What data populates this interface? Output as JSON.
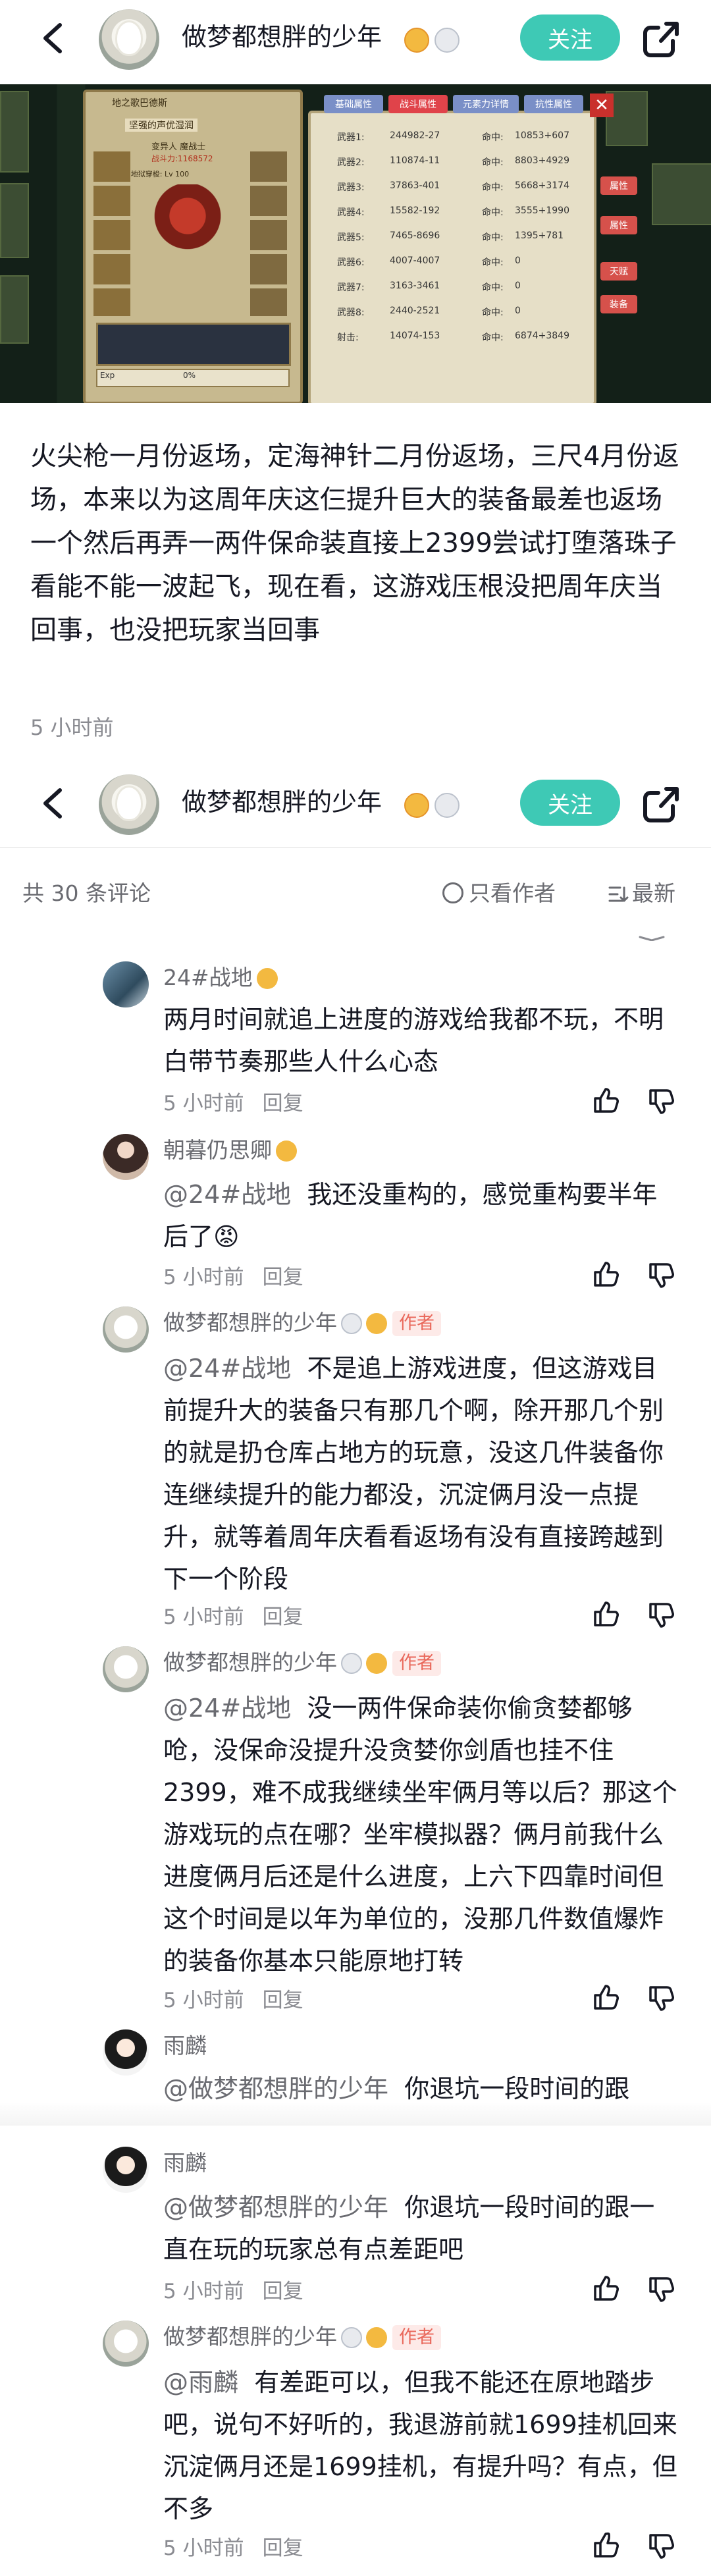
{
  "header": {
    "username": "做梦都想胖的少年",
    "follow_label": "关注"
  },
  "game_screenshot": {
    "location": "地之歌巴德斯",
    "subtitle": "坚强的声优湿润",
    "class_line": "变异人 魔战士",
    "power": "战斗力:1168572",
    "sp_line": "SRP 地狱穿梭: Lv 100",
    "exp_label": "Exp",
    "exp_pct": "0%",
    "tabs": [
      "基础属性",
      "战斗属性",
      "元素力详情",
      "抗性属性"
    ],
    "stats": [
      {
        "k": "武器1:",
        "v": "244982-27",
        "k2": "命中:",
        "v2": "10853+607"
      },
      {
        "k": "武器2:",
        "v": "110874-11",
        "k2": "命中:",
        "v2": "8803+4929"
      },
      {
        "k": "武器3:",
        "v": "37863-401",
        "k2": "命中:",
        "v2": "5668+3174"
      },
      {
        "k": "武器4:",
        "v": "15582-192",
        "k2": "命中:",
        "v2": "3555+1990"
      },
      {
        "k": "武器5:",
        "v": "7465-8696",
        "k2": "命中:",
        "v2": "1395+781"
      },
      {
        "k": "武器6:",
        "v": "4007-4007",
        "k2": "命中:",
        "v2": "0"
      },
      {
        "k": "武器7:",
        "v": "3163-3461",
        "k2": "命中:",
        "v2": "0"
      },
      {
        "k": "武器8:",
        "v": "2440-2521",
        "k2": "命中:",
        "v2": "0"
      },
      {
        "k": "射击:",
        "v": "14074-153",
        "k2": "命中:",
        "v2": "6874+3849"
      }
    ],
    "side_buttons": [
      "属性",
      "属性",
      "天赋",
      "装备"
    ]
  },
  "post": {
    "text": "火尖枪一月份返场，定海神针二月份返场，三尺4月份返场，本来以为这周年庆这仨提升巨大的装备最差也返场一个然后再弄一两件保命装直接上2399尝试打堕落珠子看能不能一波起飞，现在看，这游戏压根没把周年庆当回事，也没把玩家当回事",
    "time": "5 小时前"
  },
  "comments_header": {
    "count": "共 30 条评论",
    "only_author": "只看作者",
    "latest": "最新"
  },
  "comments": [
    {
      "name": "24#战地",
      "mention": "",
      "text": "两月时间就追上进度的游戏给我都不玩，不明白带节奏那些人什么心态",
      "time": "5 小时前",
      "reply": "回复",
      "author": false
    },
    {
      "name": "朝暮仍思卿",
      "mention": "@24#战地",
      "text": "我还没重构的，感觉重构要半年后了😡",
      "time": "5 小时前",
      "reply": "回复",
      "author": false
    },
    {
      "name": "做梦都想胖的少年",
      "mention": "@24#战地",
      "text": "不是追上游戏进度，但这游戏目前提升大的装备只有那几个啊，除开那几个别的就是扔仓库占地方的玩意，没这几件装备你连继续提升的能力都没，沉淀俩月没一点提升，就等着周年庆看看返场有没有直接跨越到下一个阶段",
      "time": "5 小时前",
      "reply": "回复",
      "author": true,
      "author_label": "作者"
    },
    {
      "name": "做梦都想胖的少年",
      "mention": "@24#战地",
      "text": "没一两件保命装你偷贪婪都够呛，没保命没提升没贪婪你剑盾也挂不住2399，难不成我继续坐牢俩月等以后？那这个游戏玩的点在哪？坐牢模拟器？俩月前我什么进度俩月后还是什么进度，上六下四靠时间但这个时间是以年为单位的，没那几件数值爆炸的装备你基本只能原地打转",
      "time": "5 小时前",
      "reply": "回复",
      "author": true,
      "author_label": "作者"
    },
    {
      "name": "雨麟",
      "mention": "@做梦都想胖的少年",
      "text": "你退坑一段时间的跟",
      "time": "",
      "reply": "",
      "author": false
    },
    {
      "name": "雨麟",
      "mention": "@做梦都想胖的少年",
      "text": "你退坑一段时间的跟一直在玩的玩家总有点差距吧",
      "time": "5 小时前",
      "reply": "回复",
      "author": false
    },
    {
      "name": "做梦都想胖的少年",
      "mention": "@雨麟",
      "text": "有差距可以，但我不能还在原地踏步吧，说句不好听的，我退游前就1699挂机回来沉淀俩月还是1699挂机，有提升吗？有点，但不多",
      "time": "5 小时前",
      "reply": "回复",
      "author": true,
      "author_label": "作者"
    }
  ]
}
